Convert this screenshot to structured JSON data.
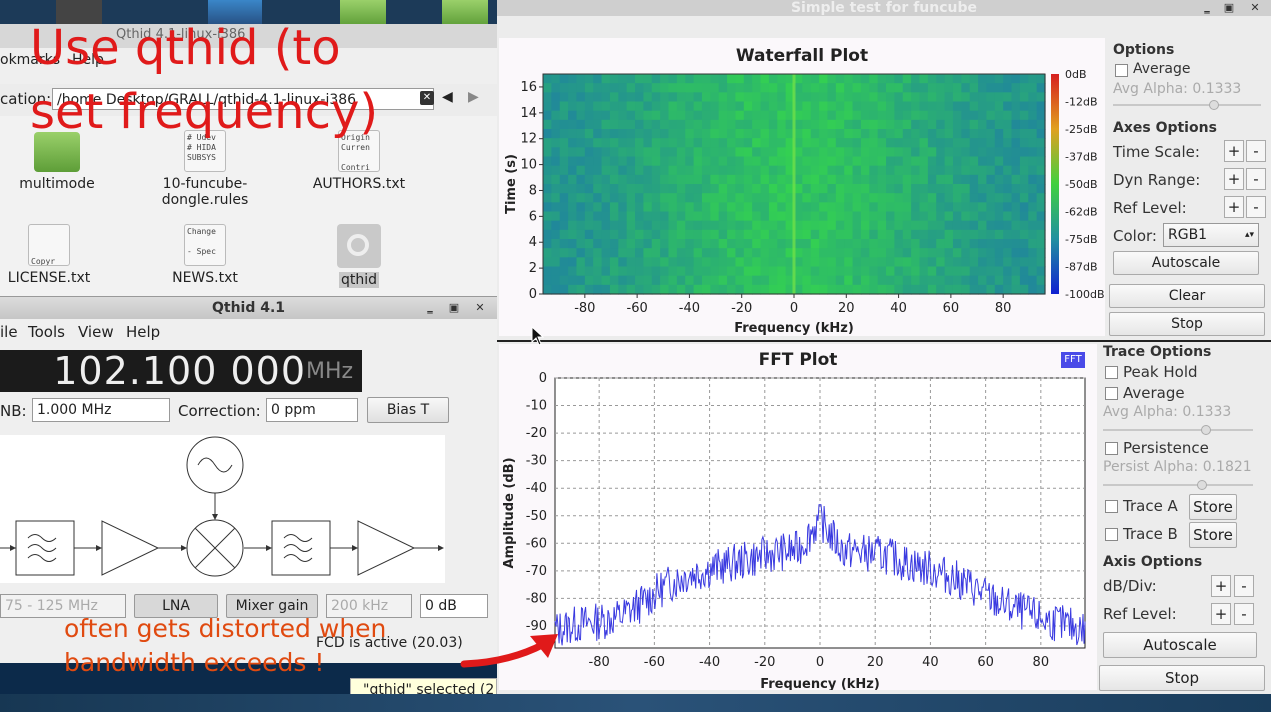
{
  "file_manager": {
    "title": "Qthid 4.1-linux-i386",
    "menu": {
      "bookmarks": "okmarks",
      "help": "Help"
    },
    "location_label": "cation:",
    "location_value": "/home          Desktop/GRALL/qthid-4.1-linux-i386",
    "files": [
      {
        "name": "multimode",
        "kind": "folder"
      },
      {
        "name": "10-funcube-dongle.rules",
        "line1": "10-funcube-",
        "line2": "dongle.rules",
        "kind": "doc",
        "preview": [
          "# Udev",
          "",
          "# HIDA",
          "SUBSYS"
        ]
      },
      {
        "name": "AUTHORS.txt",
        "kind": "doc",
        "preview": [
          "Origin",
          "Curren",
          "",
          "Contri"
        ]
      },
      {
        "name": "LICENSE.txt",
        "kind": "doc",
        "preview": [
          "",
          "",
          "",
          "Copyr"
        ]
      },
      {
        "name": "NEWS.txt",
        "kind": "doc",
        "preview": [
          "Change",
          "",
          "- Spec",
          ""
        ]
      },
      {
        "name": "qthid",
        "kind": "exec"
      }
    ]
  },
  "qthid": {
    "title": "Qthid 4.1",
    "menu": [
      "ile",
      "Tools",
      "View",
      "Help"
    ],
    "frequency": "102.100 000",
    "frequency_unit": "MHz",
    "lnb_label": "NB:",
    "lnb_value": "1.000 MHz",
    "correction_label": "Correction:",
    "correction_value": "0 ppm",
    "bias_t": "Bias T",
    "band_value": "75 - 125 MHz",
    "lna": "LNA",
    "mixer_gain": "Mixer gain",
    "filter_value": "200 kHz",
    "if_gain": "0 dB",
    "status": "FCD is active (20.03)"
  },
  "tooltip": "\"qthid\" selected (2",
  "gnuradio": {
    "title": "Simple test for funcube",
    "waterfall": {
      "title": "Waterfall Plot",
      "xlabel": "Frequency (kHz)",
      "ylabel": "Time (s)",
      "x_ticks": [
        "-80",
        "-60",
        "-40",
        "-20",
        "0",
        "20",
        "40",
        "60",
        "80"
      ],
      "y_ticks": [
        "0",
        "2",
        "4",
        "6",
        "8",
        "10",
        "12",
        "14",
        "16"
      ],
      "colorbar": [
        "0dB",
        "-12dB",
        "-25dB",
        "-37dB",
        "-50dB",
        "-62dB",
        "-75dB",
        "-87dB",
        "-100dB"
      ]
    },
    "wf_options": {
      "options_header": "Options",
      "average": "Average",
      "avg_alpha": "Avg Alpha: 0.1333",
      "axes_header": "Axes Options",
      "time_scale": "Time Scale:",
      "dyn_range": "Dyn Range:",
      "ref_level": "Ref Level:",
      "color_label": "Color:",
      "color_value": "RGB1",
      "autoscale": "Autoscale",
      "clear": "Clear",
      "stop": "Stop"
    },
    "fft": {
      "title": "FFT Plot",
      "legend": "FFT",
      "xlabel": "Frequency (kHz)",
      "ylabel": "Amplitude (dB)",
      "x_ticks": [
        "-80",
        "-60",
        "-40",
        "-20",
        "0",
        "20",
        "40",
        "60",
        "80"
      ],
      "y_ticks": [
        "0",
        "-10",
        "-20",
        "-30",
        "-40",
        "-50",
        "-60",
        "-70",
        "-80",
        "-90"
      ]
    },
    "fft_options": {
      "trace_header": "Trace Options",
      "peak_hold": "Peak Hold",
      "average": "Average",
      "avg_alpha": "Avg Alpha: 0.1333",
      "persistence": "Persistence",
      "persist_alpha": "Persist Alpha: 0.1821",
      "trace_a": "Trace A",
      "trace_b": "Trace B",
      "store": "Store",
      "axis_header": "Axis Options",
      "db_div": "dB/Div:",
      "ref_level": "Ref Level:",
      "autoscale": "Autoscale",
      "stop": "Stop"
    }
  },
  "annotations": {
    "top_line1": "Use qthid (to",
    "top_line2": "set frequency)",
    "bottom_line1": "often gets distorted when",
    "bottom_line2": "bandwidth exceeds !"
  },
  "chart_data": [
    {
      "type": "heatmap",
      "title": "Waterfall Plot",
      "xlabel": "Frequency (kHz)",
      "ylabel": "Time (s)",
      "xlim": [
        -96,
        96
      ],
      "ylim": [
        0,
        17
      ],
      "zlim_db": [
        -100,
        0
      ],
      "colormap": "RGB1",
      "description_values": {
        "center_line_freq_khz": 0
      }
    },
    {
      "type": "line",
      "title": "FFT Plot",
      "xlabel": "Frequency (kHz)",
      "ylabel": "Amplitude (dB)",
      "xlim": [
        -96,
        96
      ],
      "ylim": [
        -98,
        0
      ],
      "series": [
        {
          "name": "FFT",
          "x": [
            -96,
            -88,
            -80,
            -72,
            -64,
            -56,
            -48,
            -40,
            -32,
            -24,
            -16,
            -8,
            0,
            8,
            16,
            24,
            32,
            40,
            48,
            56,
            64,
            72,
            80,
            88,
            96
          ],
          "y": [
            -90,
            -88,
            -87,
            -85,
            -80,
            -74,
            -70,
            -68,
            -66,
            -64,
            -62,
            -61,
            -50,
            -61,
            -62,
            -63,
            -66,
            -68,
            -71,
            -75,
            -80,
            -83,
            -86,
            -88,
            -90
          ]
        }
      ]
    }
  ]
}
